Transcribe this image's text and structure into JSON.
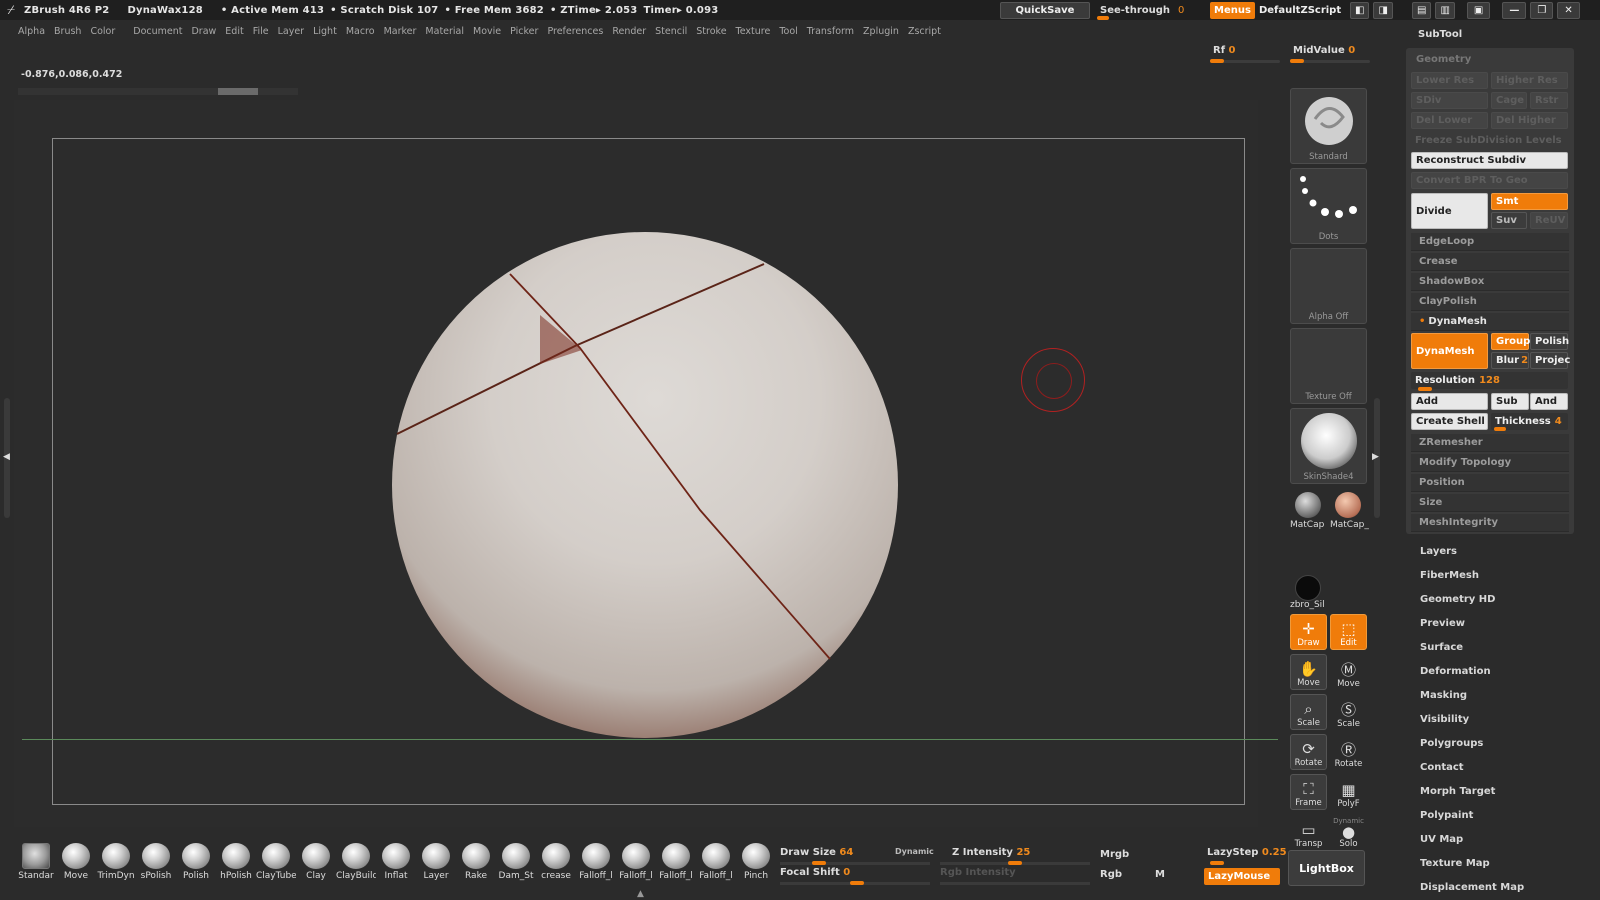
{
  "titlebar": {
    "app": "ZBrush 4R6 P2",
    "material": "DynaWax128",
    "active_mem": "• Active Mem 413",
    "scratch": "• Scratch Disk 107",
    "free_mem": "• Free Mem 3682",
    "ztime": "• ZTime▸ 2.053",
    "timer": "Timer▸ 0.093",
    "quicksave": "QuickSave",
    "seethrough_label": "See-through",
    "seethrough_value": "0",
    "menus": "Menus",
    "zscript": "DefaultZScript"
  },
  "menubar": [
    "Alpha",
    "Brush",
    "Color",
    "Document",
    "Draw",
    "Edit",
    "File",
    "Layer",
    "Light",
    "Macro",
    "Marker",
    "Material",
    "Movie",
    "Picker",
    "Preferences",
    "Render",
    "Stencil",
    "Stroke",
    "Texture",
    "Tool",
    "Transform",
    "Zplugin",
    "Zscript"
  ],
  "coords": "-0.876,0.086,0.472",
  "rf": {
    "label": "Rf",
    "value": "0"
  },
  "midvalue": {
    "label": "MidValue",
    "value": "0"
  },
  "tray": {
    "brush": "Standard",
    "stroke": "Dots",
    "alpha": "Alpha  Off",
    "texture": "Texture  Off",
    "material": "SkinShade4",
    "matcap1": "MatCap",
    "matcap2": "MatCap_",
    "color": "zbro_Sil"
  },
  "right_tools": {
    "draw": "Draw",
    "edit": "Edit",
    "move": "Move",
    "move2": "Move",
    "scale": "Scale",
    "scale2": "Scale",
    "rotate": "Rotate",
    "rotate2": "Rotate",
    "frame": "Frame",
    "polyf": "PolyF",
    "transp": "Transp",
    "solo": "Solo",
    "dynamic": "Dynamic"
  },
  "panel": {
    "subtool": "SubTool",
    "geometry": "Geometry",
    "lower_res": "Lower Res",
    "higher_res": "Higher Res",
    "sdiv": "SDiv",
    "cage": "Cage",
    "rstr": "Rstr",
    "del_lower": "Del Lower",
    "del_higher": "Del Higher",
    "freeze": "Freeze SubDivision Levels",
    "reconstruct": "Reconstruct Subdiv",
    "convert": "Convert BPR To Geo",
    "divide": "Divide",
    "smt": "Smt",
    "suv": "Suv",
    "reuv": "ReUV",
    "edgeloop": "EdgeLoop",
    "crease": "Crease",
    "shadowbox": "ShadowBox",
    "claypolish": "ClayPolish",
    "dynamesh_head": "DynaMesh",
    "dynamesh_btn": "DynaMesh",
    "group": "Group",
    "polish": "Polish",
    "blur": "Blur",
    "blur_val": "2",
    "project": "Projec",
    "resolution_label": "Resolution",
    "resolution_value": "128",
    "add": "Add",
    "sub": "Sub",
    "and": "And",
    "create_shell": "Create Shell",
    "thickness_label": "Thickness",
    "thickness_value": "4",
    "zremesher": "ZRemesher",
    "modify_topology": "Modify Topology",
    "position": "Position",
    "size": "Size",
    "meshintegrity": "MeshIntegrity"
  },
  "palette_menu": [
    "Layers",
    "FiberMesh",
    "Geometry HD",
    "Preview",
    "Surface",
    "Deformation",
    "Masking",
    "Visibility",
    "Polygroups",
    "Contact",
    "Morph Target",
    "Polypaint",
    "UV Map",
    "Texture Map",
    "Displacement Map"
  ],
  "brushes": [
    "Standar",
    "Move",
    "TrimDyn",
    "sPolish",
    "Polish",
    "hPolish",
    "ClayTube",
    "Clay",
    "ClayBuild",
    "Inflat",
    "Layer",
    "Rake",
    "Dam_St",
    "crease",
    "Falloff_l",
    "Falloff_l",
    "Falloff_l",
    "Falloff_l",
    "Pinch"
  ],
  "bottom": {
    "draw_label": "Draw",
    "size_label": "Size",
    "size_value": "64",
    "dynamic": "Dynamic",
    "focal_label": "Focal",
    "shift_label": "Shift",
    "shift_value": "0",
    "z_label": "Z",
    "intensity_label": "Intensity",
    "intensity_value": "25",
    "rgb_intensity": "Rgb  Intensity",
    "mrgb": "Mrgb",
    "rgb": "Rgb",
    "m": "M",
    "lazystep_label": "LazyStep",
    "lazystep_value": "0.25",
    "lazymouse": "LazyMouse",
    "lightbox": "LightBox"
  },
  "colors": {
    "accent": "#f07c0a",
    "sphere": "#d8d2cc",
    "crack": "#8a2b1c",
    "bg": "#2b2b2b"
  }
}
